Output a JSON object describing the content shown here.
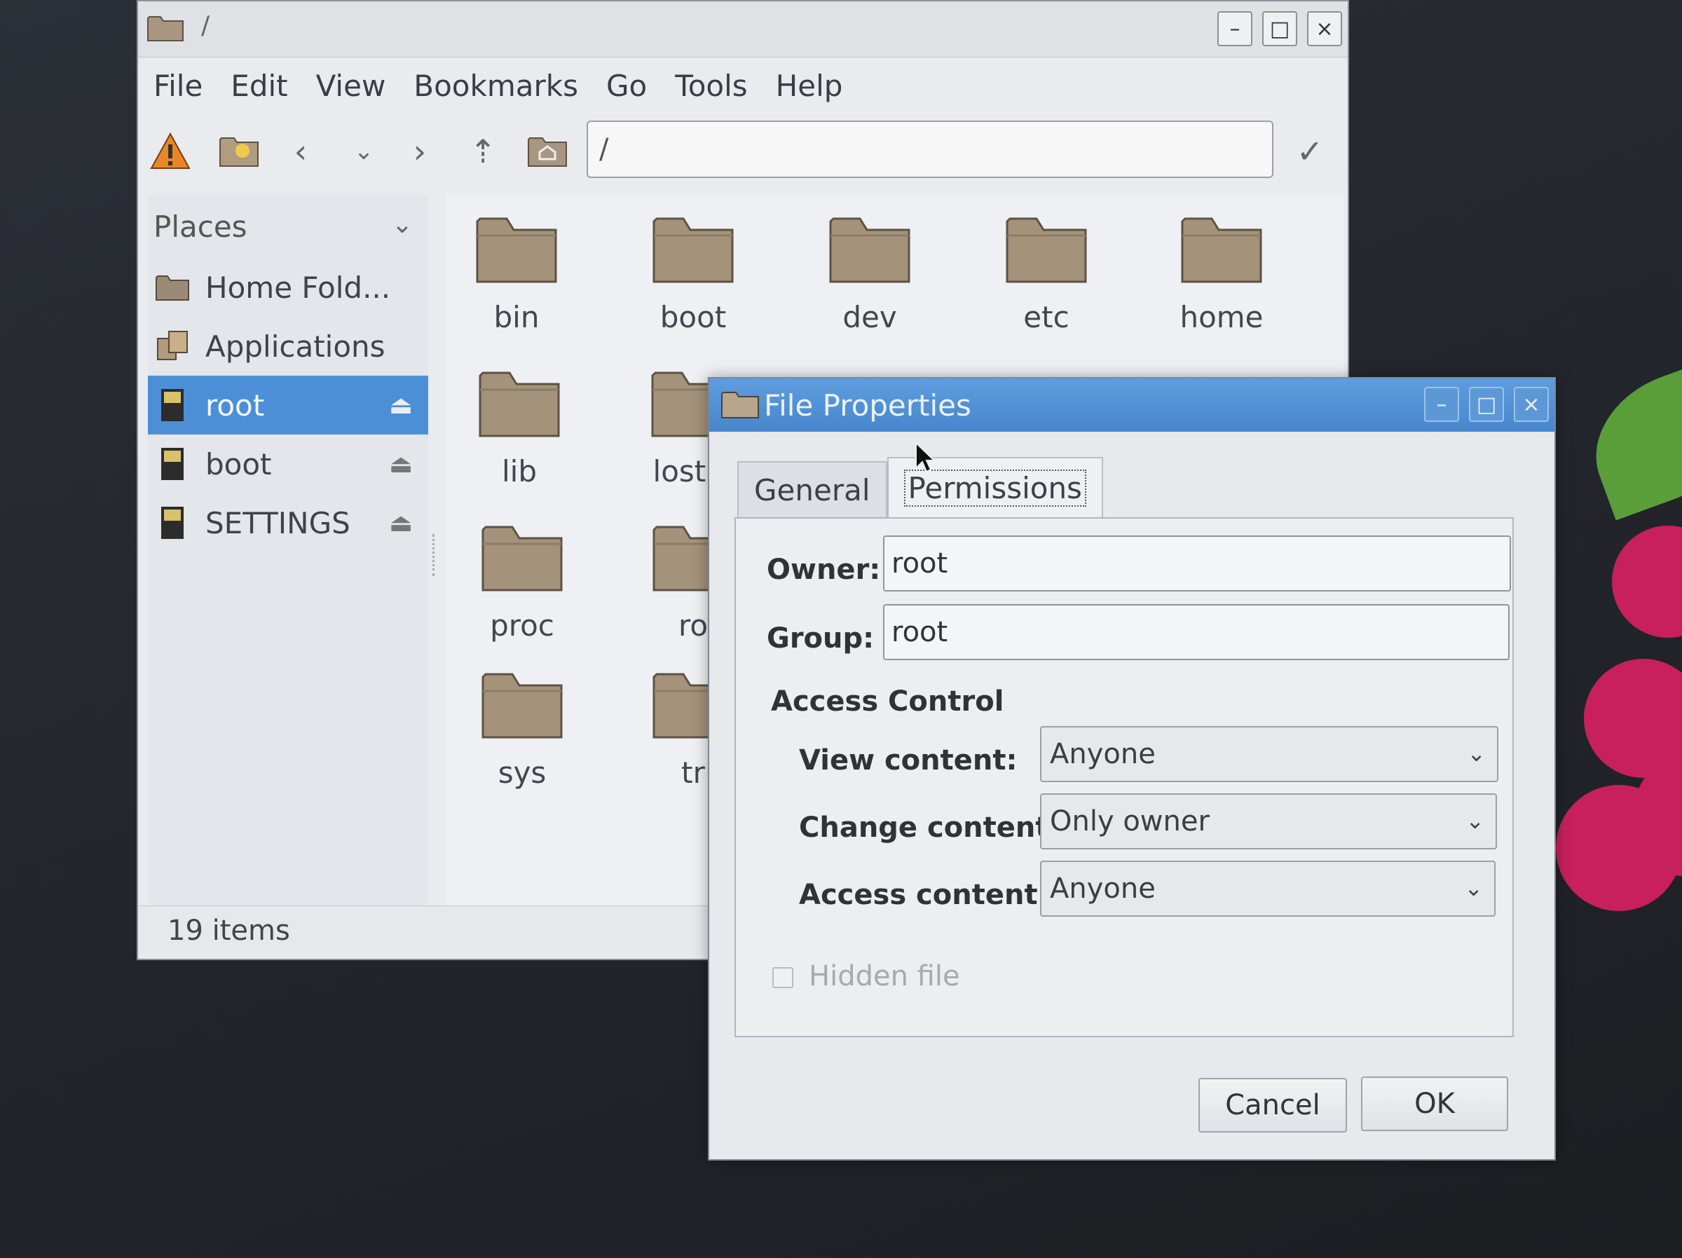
{
  "colors": {
    "selection": "#4d8fd6",
    "dialog_title": "#4786cc",
    "folder": "#a4927a"
  },
  "file_manager": {
    "title_path": "/",
    "window_buttons": {
      "minimize": "–",
      "maximize": "□",
      "close": "×"
    },
    "menu": [
      "File",
      "Edit",
      "View",
      "Bookmarks",
      "Go",
      "Tools",
      "Help"
    ],
    "address": "/",
    "places": {
      "header": "Places",
      "items": [
        {
          "label": "Home Fold...",
          "icon": "home-folder-icon",
          "ejectable": false
        },
        {
          "label": "Applications",
          "icon": "applications-icon",
          "ejectable": false
        },
        {
          "label": "root",
          "icon": "drive-icon",
          "ejectable": true,
          "selected": true
        },
        {
          "label": "boot",
          "icon": "drive-icon",
          "ejectable": true
        },
        {
          "label": "SETTINGS",
          "icon": "drive-icon",
          "ejectable": true
        }
      ]
    },
    "files": [
      "bin",
      "boot",
      "dev",
      "etc",
      "home",
      "lib",
      "lost+",
      "proc",
      "ro",
      "sys",
      "tr"
    ],
    "status": "19 items"
  },
  "dialog": {
    "title": "File Properties",
    "window_buttons": {
      "minimize": "–",
      "maximize": "□",
      "close": "×"
    },
    "tabs": [
      "General",
      "Permissions"
    ],
    "active_tab": "Permissions",
    "owner_label": "Owner:",
    "owner_value": "root",
    "group_label": "Group:",
    "group_value": "root",
    "access_control_label": "Access Control",
    "view_label": "View content:",
    "view_value": "Anyone",
    "change_label": "Change content:",
    "change_value": "Only owner",
    "access_label": "Access content:",
    "access_value": "Anyone",
    "hidden_label": "Hidden file",
    "cancel_label": "Cancel",
    "ok_label": "OK"
  }
}
